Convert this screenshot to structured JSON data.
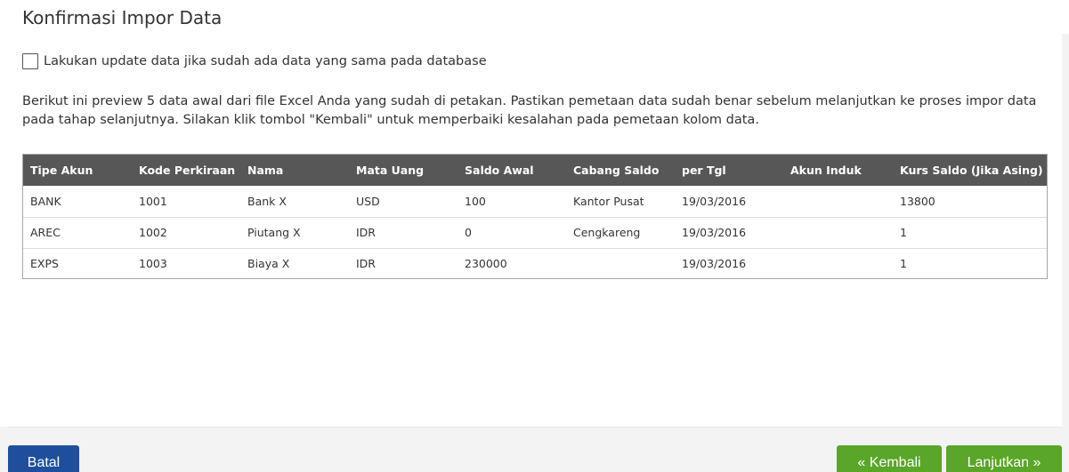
{
  "title": "Konfirmasi Impor Data",
  "update_option": {
    "label": "Lakukan update data jika sudah ada data yang sama pada database",
    "checked": false
  },
  "description": "Berikut ini preview 5 data awal dari file Excel Anda yang sudah di petakan. Pastikan pemetaan data sudah benar sebelum melanjutkan ke proses impor data pada tahap selanjutnya. Silakan klik tombol \"Kembali\" untuk memperbaiki kesalahan pada pemetaan kolom data.",
  "table": {
    "headers": [
      "Tipe Akun",
      "Kode Perkiraan",
      "Nama",
      "Mata Uang",
      "Saldo Awal",
      "Cabang Saldo",
      "per Tgl",
      "Akun Induk",
      "Kurs Saldo (Jika Asing)"
    ],
    "rows": [
      [
        "BANK",
        "1001",
        "Bank X",
        "USD",
        "100",
        "Kantor Pusat",
        "19/03/2016",
        "",
        "13800"
      ],
      [
        "AREC",
        "1002",
        "Piutang X",
        "IDR",
        "0",
        "Cengkareng",
        "19/03/2016",
        "",
        "1"
      ],
      [
        "EXPS",
        "1003",
        "Biaya X",
        "IDR",
        "230000",
        "",
        "19/03/2016",
        "",
        "1"
      ]
    ]
  },
  "buttons": {
    "batal": "Batal",
    "kembali": "« Kembali",
    "lanjutkan": "Lanjutkan »"
  },
  "colors": {
    "header_bg": "#575757",
    "primary_button": "#1f4f9c",
    "success_button": "#59a628"
  }
}
